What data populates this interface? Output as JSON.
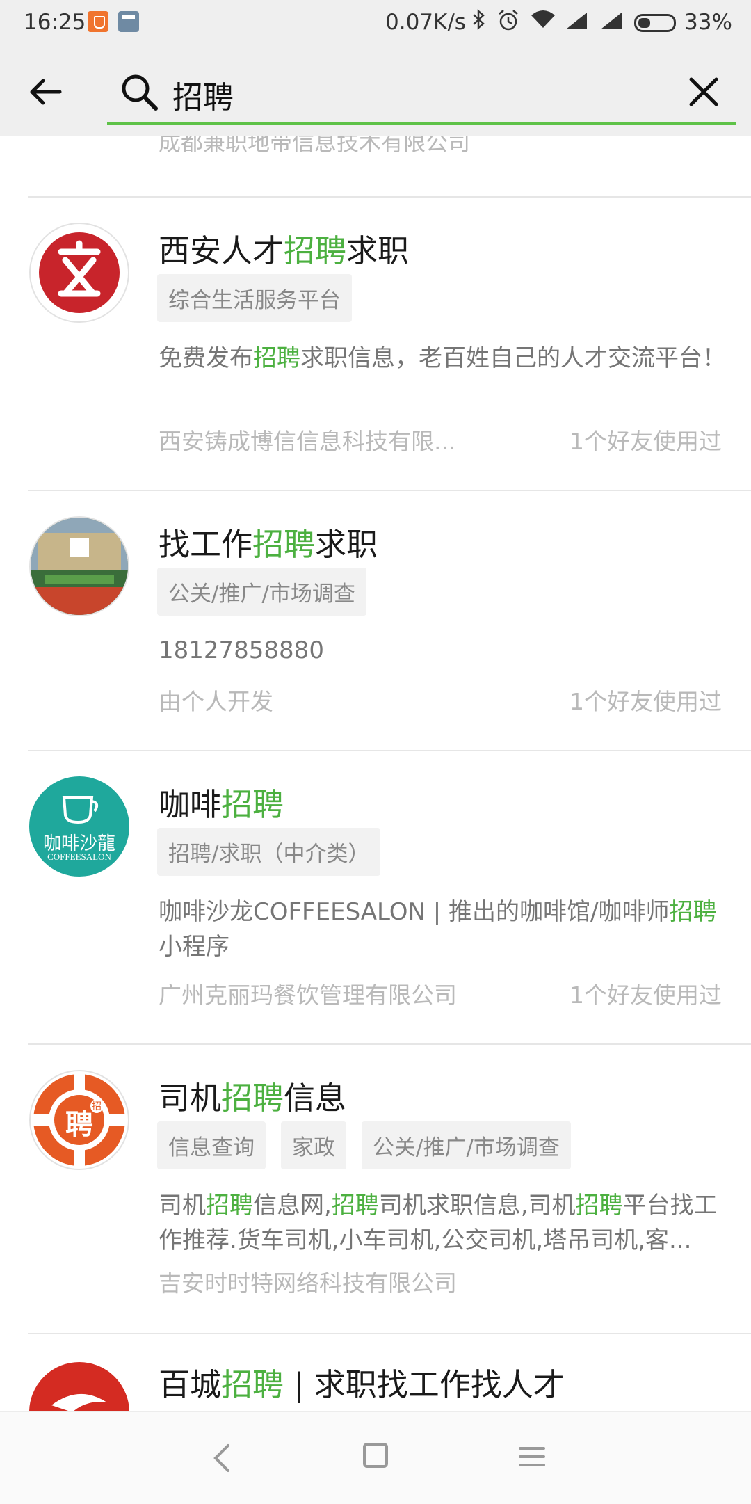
{
  "status_bar": {
    "time": "16:25",
    "speed": "0.07K/s",
    "battery": "33%",
    "icons": [
      "shield-icon",
      "calculator-icon",
      "bluetooth-icon",
      "alarm-icon",
      "wifi-icon",
      "signal-icon",
      "signal-icon",
      "battery-icon"
    ]
  },
  "search": {
    "query": "招聘",
    "accent_color": "#5ec248"
  },
  "partial_item": {
    "company": "成都兼职地带信息技术有限公司"
  },
  "results": [
    {
      "title_pre": "西安人才",
      "title_hl": "招聘",
      "title_post": "求职",
      "tags": [
        "综合生活服务平台"
      ],
      "desc_segments": [
        {
          "text": "免费发布",
          "hl": false
        },
        {
          "text": "招聘",
          "hl": true
        },
        {
          "text": "求职信息，老百姓自己的人才交流平台！",
          "hl": false
        }
      ],
      "company": "西安铸成博信信息科技有限...",
      "friends": "1个好友使用过",
      "logo": "xian-talent-logo"
    },
    {
      "title_pre": "找工作",
      "title_hl": "招聘",
      "title_post": "求职",
      "tags": [
        "公关/推广/市场调查"
      ],
      "desc_segments": [
        {
          "text": "18127858880",
          "hl": false
        }
      ],
      "company": "由个人开发",
      "friends": "1个好友使用过",
      "logo": "job-fair-photo"
    },
    {
      "title_pre": "咖啡",
      "title_hl": "招聘",
      "title_post": "",
      "tags": [
        "招聘/求职（中介类）"
      ],
      "desc_segments": [
        {
          "text": "咖啡沙龙COFFEESALON | 推出的咖啡馆/咖啡师",
          "hl": false
        },
        {
          "text": "招聘",
          "hl": true
        },
        {
          "text": "小程序",
          "hl": false
        }
      ],
      "company": "广州克丽玛餐饮管理有限公司",
      "friends": "1个好友使用过",
      "logo": "coffee-salon-logo",
      "logo_text": "咖啡沙龍",
      "logo_subtext": "COFFEESALON"
    },
    {
      "title_pre": "司机",
      "title_hl": "招聘",
      "title_post": "信息",
      "tags": [
        "信息查询",
        "家政",
        "公关/推广/市场调查"
      ],
      "desc_segments": [
        {
          "text": "司机",
          "hl": false
        },
        {
          "text": "招聘",
          "hl": true
        },
        {
          "text": "信息网,",
          "hl": false
        },
        {
          "text": "招聘",
          "hl": true
        },
        {
          "text": "司机求职信息,司机",
          "hl": false
        },
        {
          "text": "招聘",
          "hl": true
        },
        {
          "text": "平台找工作推荐.货车司机,小车司机,公交司机,塔吊司机,客...",
          "hl": false
        }
      ],
      "company": "吉安时时特网络科技有限公司",
      "friends": "",
      "logo": "driver-recruit-logo",
      "logo_text": "聘",
      "logo_badge": "招"
    },
    {
      "title_pre": "百城",
      "title_hl": "招聘",
      "title_post": " | 求职找工作找人才",
      "tags": [],
      "desc_segments": [],
      "company": "",
      "friends": "",
      "logo": "baicheng-logo"
    }
  ],
  "nav_bar": {
    "icons": [
      "nav-back-icon",
      "nav-home-icon",
      "nav-menu-icon"
    ]
  }
}
